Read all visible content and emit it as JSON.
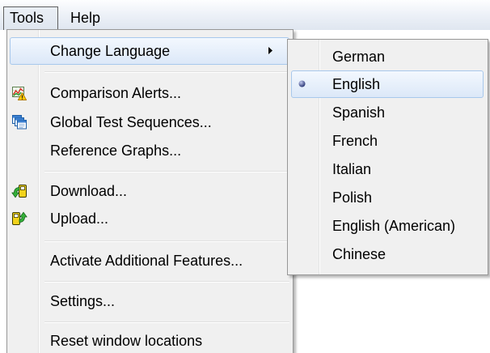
{
  "menubar": {
    "items": [
      {
        "label": "Tools",
        "open": true
      },
      {
        "label": "Help",
        "open": false
      }
    ]
  },
  "tools_menu": {
    "items": [
      {
        "label": "Change Language",
        "highlighted": true,
        "submenu": true,
        "submenu_icon": "submenu-arrow-icon"
      },
      {
        "label": "Comparison Alerts...",
        "icon": "comparison-alerts-icon"
      },
      {
        "label": "Global Test Sequences...",
        "icon": "global-test-sequences-icon"
      },
      {
        "label": "Reference Graphs..."
      },
      {
        "label": "Download...",
        "icon": "download-icon"
      },
      {
        "label": "Upload...",
        "icon": "upload-icon"
      },
      {
        "label": "Activate Additional Features..."
      },
      {
        "label": "Settings..."
      },
      {
        "label": "Reset window locations"
      }
    ]
  },
  "language_menu": {
    "items": [
      {
        "label": "German",
        "selected": false
      },
      {
        "label": "English",
        "selected": true,
        "highlighted": true,
        "marker_icon": "radio-bullet-icon"
      },
      {
        "label": "Spanish",
        "selected": false
      },
      {
        "label": "French",
        "selected": false
      },
      {
        "label": "Italian",
        "selected": false
      },
      {
        "label": "Polish",
        "selected": false
      },
      {
        "label": "English (American)",
        "selected": false
      },
      {
        "label": "Chinese",
        "selected": false
      }
    ]
  },
  "colors": {
    "menu_background": "#f0f0f0",
    "menu_border": "#979797",
    "highlight_border": "#a8c8ec",
    "highlight_fill": "#dce8f8",
    "text": "#000000",
    "radio_bullet": "#2e3a78"
  }
}
